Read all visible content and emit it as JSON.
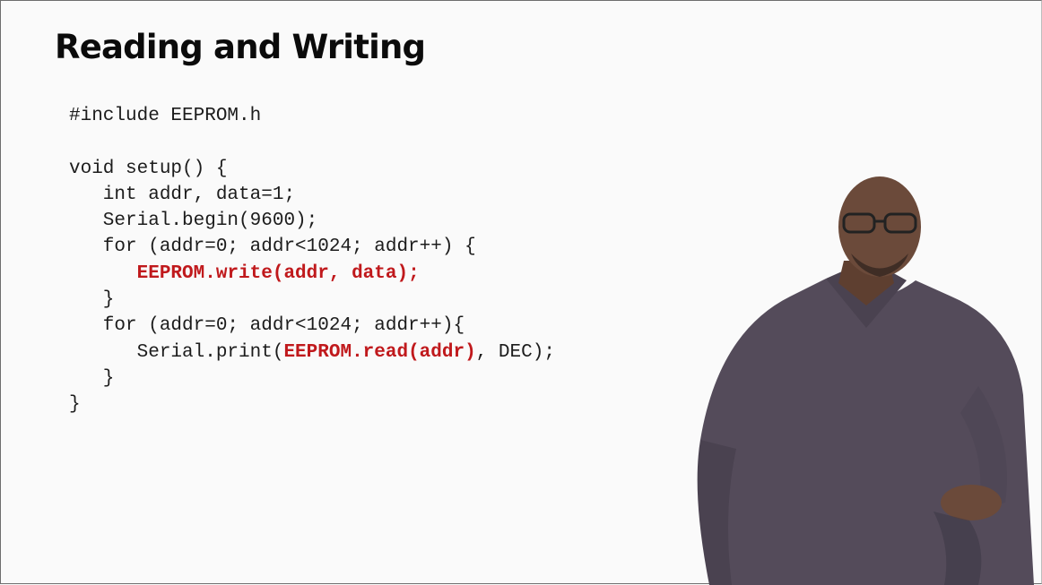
{
  "slide": {
    "title": "Reading and Writing"
  },
  "code": {
    "line1": "#include EEPROM.h",
    "line2": "",
    "line3": "void setup() {",
    "line4": "   int addr, data=1;",
    "line5": "   Serial.begin(9600);",
    "line6": "   for (addr=0; addr<1024; addr++) {",
    "line7_indent": "      ",
    "line7_highlight": "EEPROM.write(addr, data);",
    "line8": "   }",
    "line9": "   for (addr=0; addr<1024; addr++){",
    "line10_prefix": "      Serial.print(",
    "line10_highlight": "EEPROM.read(addr)",
    "line10_suffix": ", DEC);",
    "line11": "   }",
    "line12": "}",
    "highlight_color": "#c0191c"
  },
  "presenter": {
    "shirt_color": "#544b5a",
    "skin_color": "#6b4a3a"
  }
}
